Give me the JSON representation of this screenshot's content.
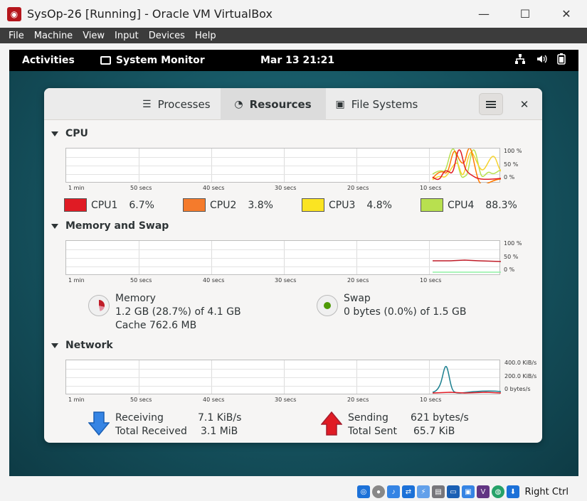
{
  "host": {
    "title": "SysOp-26 [Running] - Oracle VM VirtualBox",
    "menu": [
      "File",
      "Machine",
      "View",
      "Input",
      "Devices",
      "Help"
    ],
    "status_right": "Right Ctrl"
  },
  "gnome": {
    "activities": "Activities",
    "app_name": "System Monitor",
    "clock": "Mar 13  21:21"
  },
  "sysmon": {
    "tabs": [
      {
        "label": "Processes",
        "icon": "list-icon"
      },
      {
        "label": "Resources",
        "icon": "gauge-icon"
      },
      {
        "label": "File Systems",
        "icon": "disk-icon"
      }
    ],
    "cpu": {
      "title": "CPU",
      "y_ticks": [
        "100 %",
        "50 %",
        "0 %"
      ],
      "x_ticks": [
        "1 min",
        "50 secs",
        "40 secs",
        "30 secs",
        "20 secs",
        "10 secs"
      ],
      "cores": [
        {
          "name": "CPU1",
          "pct": "6.7%",
          "color": "#e01b24"
        },
        {
          "name": "CPU2",
          "pct": "3.8%",
          "color": "#ff7800"
        },
        {
          "name": "CPU3",
          "pct": "4.8%",
          "color": "#f6d32d"
        },
        {
          "name": "CPU4",
          "pct": "88.3%",
          "color": "#b8e04f"
        }
      ]
    },
    "memory": {
      "title": "Memory and Swap",
      "y_ticks": [
        "100 %",
        "50 %",
        "0 %"
      ],
      "x_ticks": [
        "1 min",
        "50 secs",
        "40 secs",
        "30 secs",
        "20 secs",
        "10 secs"
      ],
      "mem_label": "Memory",
      "mem_value": "1.2 GB (28.7%) of 4.1 GB",
      "mem_cache": "Cache 762.6 MB",
      "mem_color": "#c01c28",
      "swap_label": "Swap",
      "swap_value": "0 bytes (0.0%) of 1.5 GB",
      "swap_color": "#4e9a06"
    },
    "network": {
      "title": "Network",
      "y_ticks": [
        "400.0 KiB/s",
        "200.0 KiB/s",
        "0 bytes/s"
      ],
      "x_ticks": [
        "1 min",
        "50 secs",
        "40 secs",
        "30 secs",
        "20 secs",
        "10 secs"
      ],
      "receiving_label": "Receiving",
      "receiving_value": "7.1 KiB/s",
      "total_received_label": "Total Received",
      "total_received_value": "3.1 MiB",
      "sending_label": "Sending",
      "sending_value": "621 bytes/s",
      "total_sent_label": "Total Sent",
      "total_sent_value": "65.7 KiB",
      "recv_color": "#1c71d8",
      "send_color": "#e01b24"
    }
  }
}
